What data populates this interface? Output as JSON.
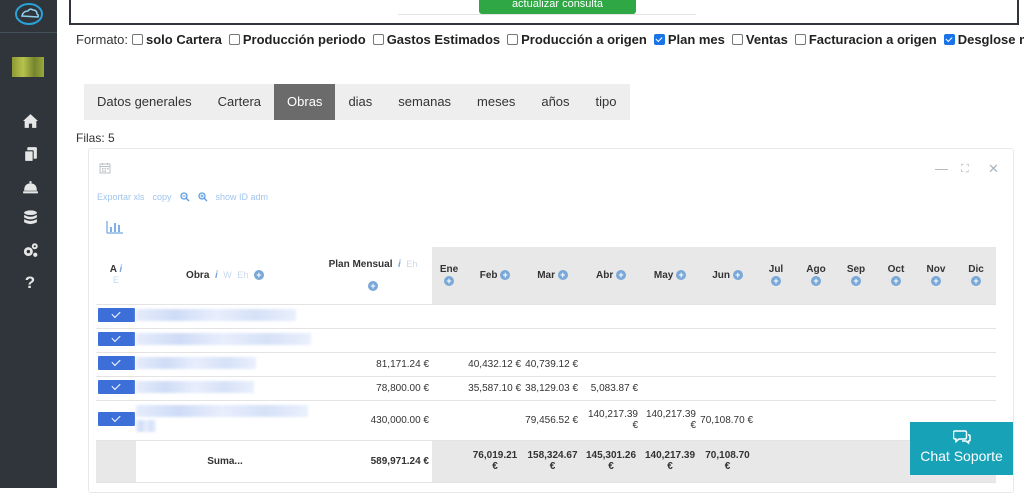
{
  "sidebar": {
    "icons": [
      "cloud-logo",
      "home-icon",
      "documents-icon",
      "service-bell-icon",
      "database-icon",
      "settings-gears-icon",
      "question-icon"
    ]
  },
  "top": {
    "update_button_label": "actualizar consulta"
  },
  "format": {
    "label": "Formato:",
    "options": [
      {
        "label": "solo Cartera",
        "checked": false
      },
      {
        "label": "Producción periodo",
        "checked": false
      },
      {
        "label": "Gastos Estimados",
        "checked": false
      },
      {
        "label": "Producción a origen",
        "checked": false
      },
      {
        "label": "Plan mes",
        "checked": true
      },
      {
        "label": "Ventas",
        "checked": false
      },
      {
        "label": "Facturacion a origen",
        "checked": false
      },
      {
        "label": "Desglose mensual",
        "checked": true
      }
    ]
  },
  "tabs": [
    {
      "label": "Datos generales",
      "active": false
    },
    {
      "label": "Cartera",
      "active": false
    },
    {
      "label": "Obras",
      "active": true
    },
    {
      "label": "dias",
      "active": false
    },
    {
      "label": "semanas",
      "active": false
    },
    {
      "label": "meses",
      "active": false
    },
    {
      "label": "años",
      "active": false
    },
    {
      "label": "tipo",
      "active": false
    }
  ],
  "filas_label": "Filas: 5",
  "portlet": {
    "tools": {
      "export": "Exportar xls",
      "copy": "copy",
      "show_id": "show ID adm"
    },
    "controls": {
      "minimize": "—",
      "expand": "⛶",
      "close": "✕"
    }
  },
  "table": {
    "headers": {
      "a": "A",
      "a_info": "i",
      "a_sub": "E",
      "obra": "Obra",
      "obra_info": "i",
      "obra_w": "W",
      "obra_eh": "Eh",
      "plan": "Plan Mensual",
      "plan_info": "i",
      "plan_eh": "Eh",
      "months": [
        "Ene",
        "Feb",
        "Mar",
        "Abr",
        "May",
        "Jun",
        "Jul",
        "Ago",
        "Sep",
        "Oct",
        "Nov",
        "Dic"
      ]
    },
    "rows": [
      {
        "plan": "",
        "months": [
          "",
          "",
          "",
          "",
          "",
          "",
          "",
          "",
          "",
          "",
          "",
          ""
        ]
      },
      {
        "plan": "",
        "months": [
          "",
          "",
          "",
          "",
          "",
          "",
          "",
          "",
          "",
          "",
          "",
          ""
        ]
      },
      {
        "plan": "81,171.24 €",
        "months": [
          "",
          "40,432.12 €",
          "40,739.12 €",
          "",
          "",
          "",
          "",
          "",
          "",
          "",
          "",
          ""
        ]
      },
      {
        "plan": "78,800.00 €",
        "months": [
          "",
          "35,587.10 €",
          "38,129.03 €",
          "5,083.87 €",
          "",
          "",
          "",
          "",
          "",
          "",
          "",
          ""
        ]
      },
      {
        "plan": "430,000.00 €",
        "months": [
          "",
          "",
          "79,456.52 €",
          "140,217.39 €",
          "140,217.39 €",
          "70,108.70 €",
          "",
          "",
          "",
          "",
          "",
          ""
        ]
      }
    ],
    "sum": {
      "label": "Suma...",
      "plan": "589,971.24 €",
      "feb": "76,019.21",
      "mar": "158,324.67",
      "abr": "145,301.26",
      "may": "140,217.39",
      "jun": "70,108.70",
      "euro": "€"
    }
  },
  "chat": {
    "label": "Chat Soporte"
  }
}
